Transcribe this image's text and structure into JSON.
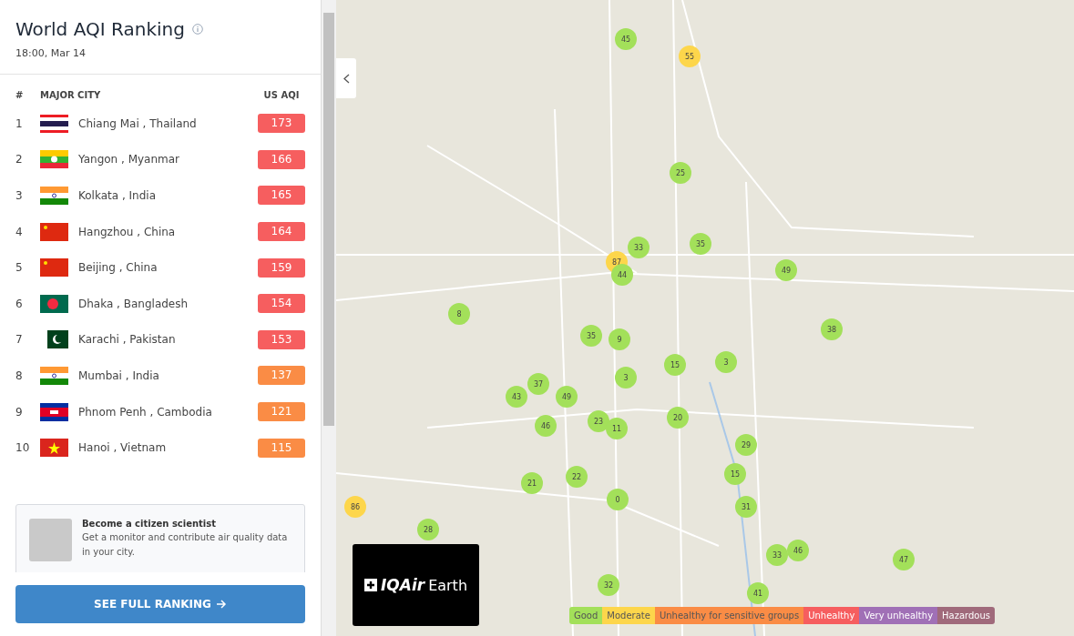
{
  "panel": {
    "title": "World AQI Ranking",
    "updated": "18:00, Mar 14",
    "columns": [
      "#",
      "MAJOR CITY",
      "US AQI"
    ],
    "rows": [
      {
        "rank": "1",
        "city": "Chiang Mai , Thailand",
        "aqi": "173",
        "color": "#f65e5f"
      },
      {
        "rank": "2",
        "city": "Yangon , Myanmar",
        "aqi": "166",
        "color": "#f65e5f"
      },
      {
        "rank": "3",
        "city": "Kolkata , India",
        "aqi": "165",
        "color": "#f65e5f"
      },
      {
        "rank": "4",
        "city": "Hangzhou , China",
        "aqi": "164",
        "color": "#f65e5f"
      },
      {
        "rank": "5",
        "city": "Beijing , China",
        "aqi": "159",
        "color": "#f65e5f"
      },
      {
        "rank": "6",
        "city": "Dhaka , Bangladesh",
        "aqi": "154",
        "color": "#f65e5f"
      },
      {
        "rank": "7",
        "city": "Karachi , Pakistan",
        "aqi": "153",
        "color": "#f65e5f"
      },
      {
        "rank": "8",
        "city": "Mumbai , India",
        "aqi": "137",
        "color": "#fa8c45"
      },
      {
        "rank": "9",
        "city": "Phnom Penh , Cambodia",
        "aqi": "121",
        "color": "#fa8c45"
      },
      {
        "rank": "10",
        "city": "Hanoi , Vietnam",
        "aqi": "115",
        "color": "#fa8c45"
      }
    ],
    "promo": {
      "title": "Become a citizen scientist",
      "text": "Get a monitor and contribute air quality data in your city."
    },
    "button": "SEE FULL RANKING"
  },
  "map": {
    "logo": {
      "brand": "IQAir",
      "product": "Earth"
    },
    "markers": [
      {
        "value": "45",
        "color": "#a3e05a"
      },
      {
        "value": "55",
        "color": "#fdd64b"
      },
      {
        "value": "25",
        "color": "#a3e05a"
      },
      {
        "value": "33",
        "color": "#a3e05a"
      },
      {
        "value": "35",
        "color": "#a3e05a"
      },
      {
        "value": "87",
        "color": "#fdd64b"
      },
      {
        "value": "44",
        "color": "#a3e05a"
      },
      {
        "value": "49",
        "color": "#a3e05a"
      },
      {
        "value": "8",
        "color": "#a3e05a"
      },
      {
        "value": "38",
        "color": "#a3e05a"
      },
      {
        "value": "35",
        "color": "#a3e05a"
      },
      {
        "value": "9",
        "color": "#a3e05a"
      },
      {
        "value": "15",
        "color": "#a3e05a"
      },
      {
        "value": "3",
        "color": "#a3e05a"
      },
      {
        "value": "3",
        "color": "#a3e05a"
      },
      {
        "value": "37",
        "color": "#a3e05a"
      },
      {
        "value": "43",
        "color": "#a3e05a"
      },
      {
        "value": "49",
        "color": "#a3e05a"
      },
      {
        "value": "46",
        "color": "#a3e05a"
      },
      {
        "value": "23",
        "color": "#a3e05a"
      },
      {
        "value": "11",
        "color": "#a3e05a"
      },
      {
        "value": "20",
        "color": "#a3e05a"
      },
      {
        "value": "29",
        "color": "#a3e05a"
      },
      {
        "value": "15",
        "color": "#a3e05a"
      },
      {
        "value": "21",
        "color": "#a3e05a"
      },
      {
        "value": "22",
        "color": "#a3e05a"
      },
      {
        "value": "0",
        "color": "#a3e05a"
      },
      {
        "value": "31",
        "color": "#a3e05a"
      },
      {
        "value": "86",
        "color": "#fdd64b"
      },
      {
        "value": "28",
        "color": "#a3e05a"
      },
      {
        "value": "33",
        "color": "#a3e05a"
      },
      {
        "value": "46",
        "color": "#a3e05a"
      },
      {
        "value": "47",
        "color": "#a3e05a"
      },
      {
        "value": "32",
        "color": "#a3e05a"
      },
      {
        "value": "41",
        "color": "#a3e05a"
      }
    ],
    "legend": [
      {
        "label": "Good",
        "color": "#a3e05a"
      },
      {
        "label": "Moderate",
        "color": "#fdd64b"
      },
      {
        "label": "Unhealthy for sensitive groups",
        "color": "#fa8c45"
      },
      {
        "label": "Unhealthy",
        "color": "#f65e5f"
      },
      {
        "label": "Very unhealthy",
        "color": "#a070b6"
      },
      {
        "label": "Hazardous",
        "color": "#a06a7b"
      }
    ]
  }
}
